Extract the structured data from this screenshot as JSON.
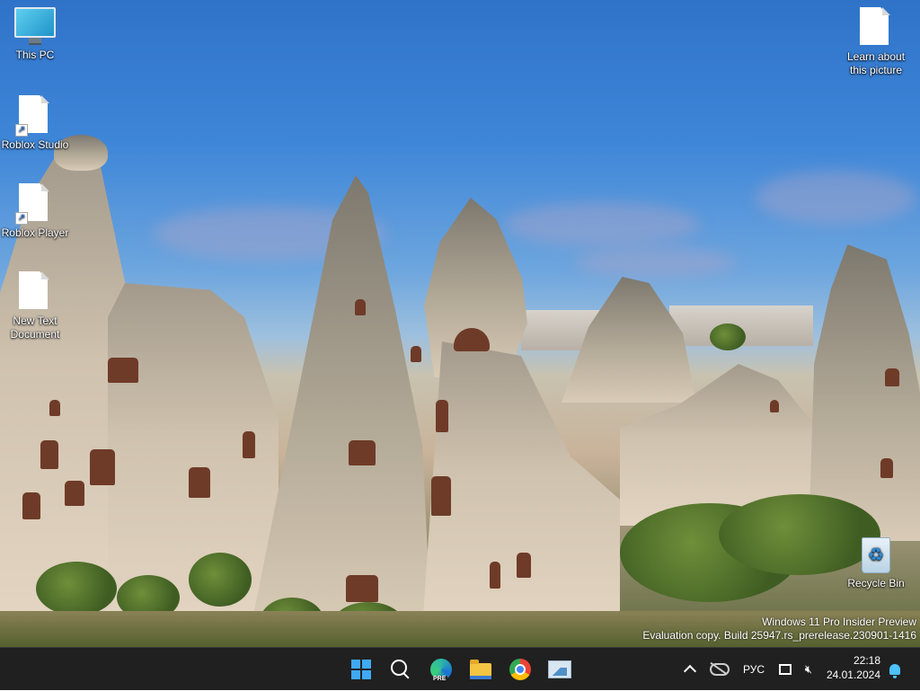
{
  "desktop": {
    "icons": [
      {
        "label": "This PC",
        "icon": "computer-icon"
      },
      {
        "label": "Roblox Studio",
        "icon": "file-shortcut-icon"
      },
      {
        "label": "Roblox Player",
        "icon": "file-shortcut-icon"
      },
      {
        "label": "New Text Document",
        "icon": "text-file-icon"
      },
      {
        "label": "Learn about this picture",
        "icon": "file-icon"
      },
      {
        "label": "Recycle Bin",
        "icon": "recycle-bin-icon"
      }
    ],
    "wallpaper": "landscape-rock-formations"
  },
  "watermark": {
    "line1": "Windows 11 Pro Insider Preview",
    "line2": "Evaluation copy. Build 25947.rs_prerelease.230901-1416"
  },
  "taskbar": {
    "apps": [
      {
        "name": "start",
        "icon": "windows-logo-icon"
      },
      {
        "name": "search",
        "icon": "search-icon"
      },
      {
        "name": "edge-preview",
        "icon": "edge-icon",
        "badge": "PRE"
      },
      {
        "name": "file-explorer",
        "icon": "folder-icon"
      },
      {
        "name": "chrome",
        "icon": "chrome-icon"
      },
      {
        "name": "photos",
        "icon": "photos-icon"
      }
    ],
    "tray": {
      "language": "РУС",
      "time": "22:18",
      "date": "24.01.2024"
    }
  },
  "colors": {
    "taskbar_bg": "#202020",
    "accent": "#3fa9f5"
  }
}
